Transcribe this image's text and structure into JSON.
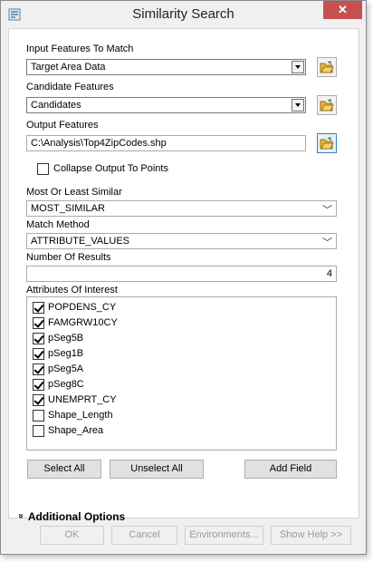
{
  "window": {
    "title": "Similarity Search",
    "close_glyph": "✕"
  },
  "fields": {
    "input_features": {
      "label": "Input Features To Match",
      "value": "Target Area Data"
    },
    "candidate_features": {
      "label": "Candidate Features",
      "value": "Candidates"
    },
    "output_features": {
      "label": "Output Features",
      "value": "C:\\Analysis\\Top4ZipCodes.shp"
    },
    "collapse_output": {
      "label": "Collapse Output To Points",
      "checked": false
    },
    "most_or_least": {
      "label": "Most Or Least Similar",
      "value": "MOST_SIMILAR"
    },
    "match_method": {
      "label": "Match Method",
      "value": "ATTRIBUTE_VALUES"
    },
    "num_results": {
      "label": "Number Of Results",
      "value": "4"
    }
  },
  "attributes": {
    "label": "Attributes Of Interest",
    "items": [
      {
        "label": "POPDENS_CY",
        "checked": true
      },
      {
        "label": "FAMGRW10CY",
        "checked": true
      },
      {
        "label": "pSeg5B",
        "checked": true
      },
      {
        "label": "pSeg1B",
        "checked": true
      },
      {
        "label": "pSeg5A",
        "checked": true
      },
      {
        "label": "pSeg8C",
        "checked": true
      },
      {
        "label": "UNEMPRT_CY",
        "checked": true
      },
      {
        "label": "Shape_Length",
        "checked": false
      },
      {
        "label": "Shape_Area",
        "checked": false
      }
    ]
  },
  "list_buttons": {
    "select_all": "Select All",
    "unselect_all": "Unselect All",
    "add_field": "Add Field"
  },
  "additional_options": {
    "label": "Additional Options",
    "chevron": "»"
  },
  "footer": {
    "ok": "OK",
    "cancel": "Cancel",
    "environments": "Environments...",
    "show_help": "Show Help >>"
  },
  "icons": {
    "title": "tool-icon",
    "browse": "folder-open-icon"
  },
  "colors": {
    "close_button": "#c75050",
    "active_border": "#3c7fb1"
  }
}
